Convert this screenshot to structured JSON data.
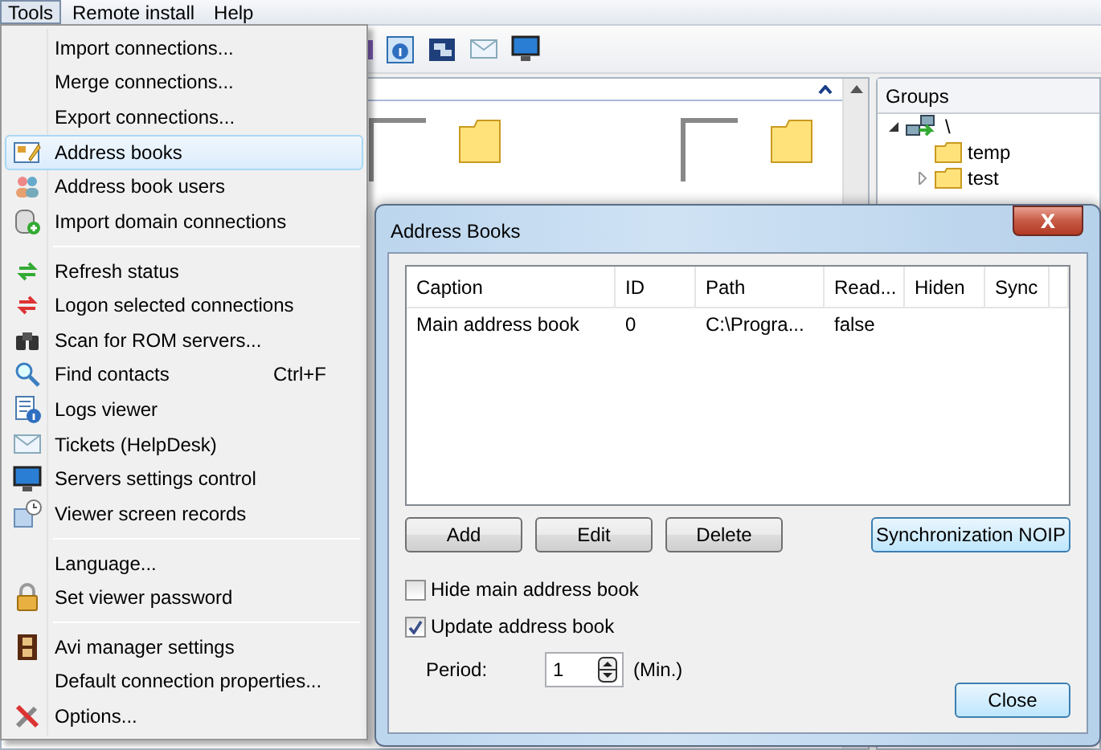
{
  "menubar": [
    {
      "label": "Tools",
      "selected": true
    },
    {
      "label": "Remote install",
      "selected": false
    },
    {
      "label": "Help",
      "selected": false
    }
  ],
  "groups": {
    "title": "Groups",
    "tree": [
      {
        "label": "\\",
        "expanded": true,
        "children": [
          {
            "label": "temp"
          },
          {
            "label": "test",
            "expanded": false,
            "has_children": true
          }
        ]
      }
    ]
  },
  "menu": {
    "sections": [
      [
        {
          "label": "Import connections...",
          "selected": false
        },
        {
          "label": "Merge connections...",
          "selected": false
        },
        {
          "label": "Export connections...",
          "selected": false
        },
        {
          "label": "Address books",
          "selected": true
        },
        {
          "label": "Address book users",
          "selected": false
        },
        {
          "label": "Import domain connections",
          "selected": false
        }
      ],
      [
        {
          "label": "Refresh status",
          "selected": false
        },
        {
          "label": "Logon selected connections",
          "selected": false
        },
        {
          "label": "Scan for ROM servers...",
          "selected": false
        },
        {
          "label": "Find contacts",
          "shortcut": "Ctrl+F",
          "selected": false
        },
        {
          "label": "Logs viewer",
          "selected": false
        },
        {
          "label": "Tickets (HelpDesk)",
          "selected": false
        },
        {
          "label": "Servers settings control",
          "selected": false
        },
        {
          "label": "Viewer screen records",
          "selected": false
        }
      ],
      [
        {
          "label": "Language...",
          "selected": false
        },
        {
          "label": "Set viewer password",
          "selected": false
        }
      ],
      [
        {
          "label": "Avi manager settings",
          "selected": false
        },
        {
          "label": "Default connection properties...",
          "selected": false
        },
        {
          "label": "Options...",
          "selected": false
        }
      ]
    ]
  },
  "dialog": {
    "title": "Address Books",
    "close": "X",
    "table": {
      "columns": [
        "Caption",
        "ID",
        "Path",
        "Read...",
        "Hiden",
        "Sync"
      ],
      "rows": [
        [
          "Main address book",
          "0",
          "C:\\Progra...",
          "false"
        ]
      ]
    },
    "buttons": [
      {
        "label": "Add",
        "highlighted": false
      },
      {
        "label": "Edit",
        "highlighted": false
      },
      {
        "label": "Delete",
        "highlighted": false
      }
    ],
    "sync_button": {
      "label": "Synchronization NOIP",
      "highlighted": true
    },
    "checkboxes": [
      {
        "label": "Hide main address book",
        "checked": false
      },
      {
        "label": "Update address book",
        "checked": true
      }
    ],
    "period": {
      "label": "Period:",
      "value": "1",
      "unit": "(Min.)"
    },
    "close_button": {
      "label": "Close",
      "highlighted": true
    }
  }
}
